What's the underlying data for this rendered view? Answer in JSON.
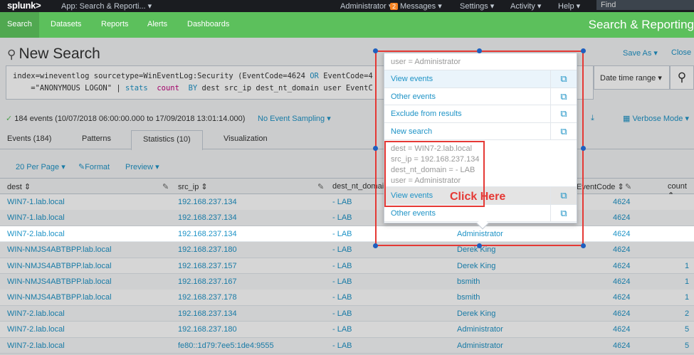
{
  "topbar": {
    "logo": "splunk>",
    "app": "App: Search & Reporti... ▾",
    "user": "Administrator ▾",
    "messages_count": "2",
    "messages": "Messages ▾",
    "settings": "Settings ▾",
    "activity": "Activity ▾",
    "help": "Help ▾",
    "find": "Find"
  },
  "navbar": {
    "items": [
      "Search",
      "Datasets",
      "Reports",
      "Alerts",
      "Dashboards"
    ],
    "app_title": "Search & Reporting"
  },
  "header": {
    "title": "New Search",
    "save_as": "Save As ▾",
    "close": "Close"
  },
  "search": {
    "line1_a": "index=wineventlog sourcetype=WinEventLog:Security (EventCode=4624 ",
    "line1_or": "OR",
    "line1_b": " EventCode=4",
    "line2_a": "    =\"ANONYMOUS LOGON\" | ",
    "line2_stats": "stats",
    "line2_count": "count",
    "line2_by": "BY",
    "line2_b": " dest src_ip dest_nt_domain user EventC",
    "time_range": "Date time range ▾",
    "go": "⚲"
  },
  "status": {
    "check": "✓",
    "events": "184 events (10/07/2018 06:00:00.000 to 17/09/2018 13:01:14.000)",
    "sampling": "No Event Sampling ▾",
    "verbose": "Verbose Mode ▾",
    "download": "⤓"
  },
  "tabs": [
    "Events (184)",
    "Patterns",
    "Statistics (10)",
    "Visualization"
  ],
  "toolbar": {
    "per_page": "20 Per Page ▾",
    "format": "✎Format",
    "preview": "Preview ▾"
  },
  "table": {
    "headers": [
      "dest ⇕",
      "src_ip ⇕",
      "dest_nt_domai",
      "EventCode ⇕",
      "count ⇕"
    ],
    "rows": [
      {
        "dest": "WIN7-1.lab.local",
        "src_ip": "192.168.237.134",
        "domain": "- LAB",
        "user": "",
        "code": "4624",
        "count": ""
      },
      {
        "dest": "WIN7-1.lab.local",
        "src_ip": "192.168.237.134",
        "domain": "- LAB",
        "user": "",
        "code": "4624",
        "count": ""
      },
      {
        "dest": "WIN7-2.lab.local",
        "src_ip": "192.168.237.134",
        "domain": "- LAB",
        "user": "Administrator",
        "code": "4624",
        "count": ""
      },
      {
        "dest": "WIN-NMJS4ABTBPP.lab.local",
        "src_ip": "192.168.237.180",
        "domain": "- LAB",
        "user": "Derek King",
        "code": "4624",
        "count": ""
      },
      {
        "dest": "WIN-NMJS4ABTBPP.lab.local",
        "src_ip": "192.168.237.157",
        "domain": "- LAB",
        "user": "Derek King",
        "code": "4624",
        "count": "1"
      },
      {
        "dest": "WIN-NMJS4ABTBPP.lab.local",
        "src_ip": "192.168.237.167",
        "domain": "- LAB",
        "user": "bsmith",
        "code": "4624",
        "count": "1"
      },
      {
        "dest": "WIN-NMJS4ABTBPP.lab.local",
        "src_ip": "192.168.237.178",
        "domain": "- LAB",
        "user": "bsmith",
        "code": "4624",
        "count": "1"
      },
      {
        "dest": "WIN7-2.lab.local",
        "src_ip": "192.168.237.134",
        "domain": "- LAB",
        "user": "Derek King",
        "code": "4624",
        "count": "2"
      },
      {
        "dest": "WIN7-2.lab.local",
        "src_ip": "192.168.237.180",
        "domain": "- LAB",
        "user": "Administrator",
        "code": "4624",
        "count": "5"
      },
      {
        "dest": "WIN7-2.lab.local",
        "src_ip": "fe80::1d79:7ee5:1de4:9555",
        "domain": "- LAB",
        "user": "Administrator",
        "code": "4624",
        "count": "5"
      }
    ]
  },
  "popup": {
    "header": "user = Administrator",
    "items": [
      "View events",
      "Other events",
      "Exclude from results",
      "New search"
    ],
    "info": [
      "dest = WIN7-2.lab.local",
      "src_ip = 192.168.237.134",
      "dest_nt_domain = - LAB",
      "user = Administrator"
    ],
    "items2": [
      "View events",
      "Other events"
    ],
    "ext_icon": "⧉"
  },
  "annotation": {
    "text": "Click Here",
    "color": "#e53935"
  }
}
